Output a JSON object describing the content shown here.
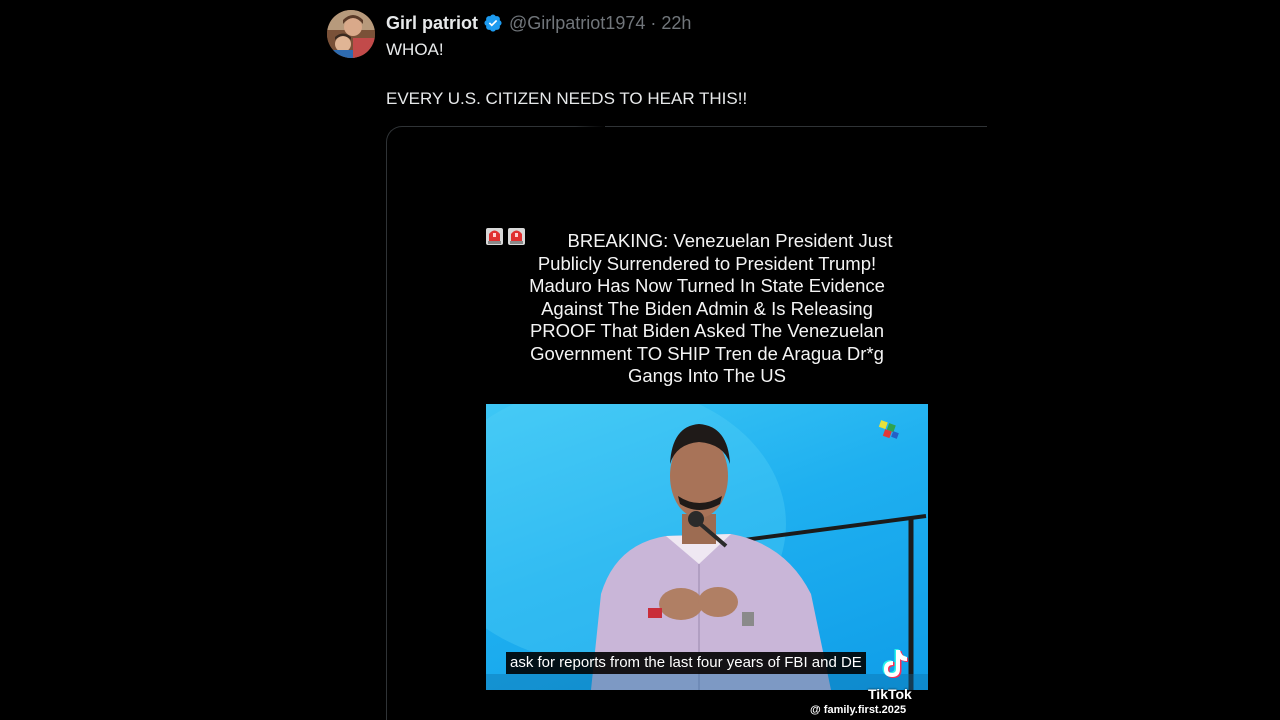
{
  "post": {
    "display_name": "Girl patriot",
    "handle": "@Girlpatriot1974",
    "separator": "·",
    "timestamp": "22h",
    "text_lines": [
      "WHOA!",
      "EVERY U.S. CITIZEN NEEDS TO HEAR THIS!!"
    ]
  },
  "media": {
    "headline_lines": [
      "BREAKING: Venezuelan President Just",
      "Publicly Surrendered to President Trump!",
      "Maduro Has Now Turned In State Evidence",
      "Against The Biden Admin & Is Releasing",
      "PROOF That Biden Asked The Venezuelan",
      "Government TO SHIP Tren de Aragua Dr*g",
      "Gangs Into The US"
    ],
    "caption": "ask for reports from the last four years of FBI and DE",
    "watermark_brand": "TikTok",
    "watermark_user": "@ family.first.2025"
  },
  "icons": {
    "verified": "verified-badge-icon",
    "siren": "police-siren-icon",
    "tiktok": "tiktok-logo-icon",
    "channel": "tv-channel-logo-icon"
  },
  "colors": {
    "background": "#000000",
    "text_primary": "#e7e9ea",
    "text_secondary": "#71767b",
    "verified_blue": "#1d9bf0",
    "video_background": "#1fb0f0"
  }
}
